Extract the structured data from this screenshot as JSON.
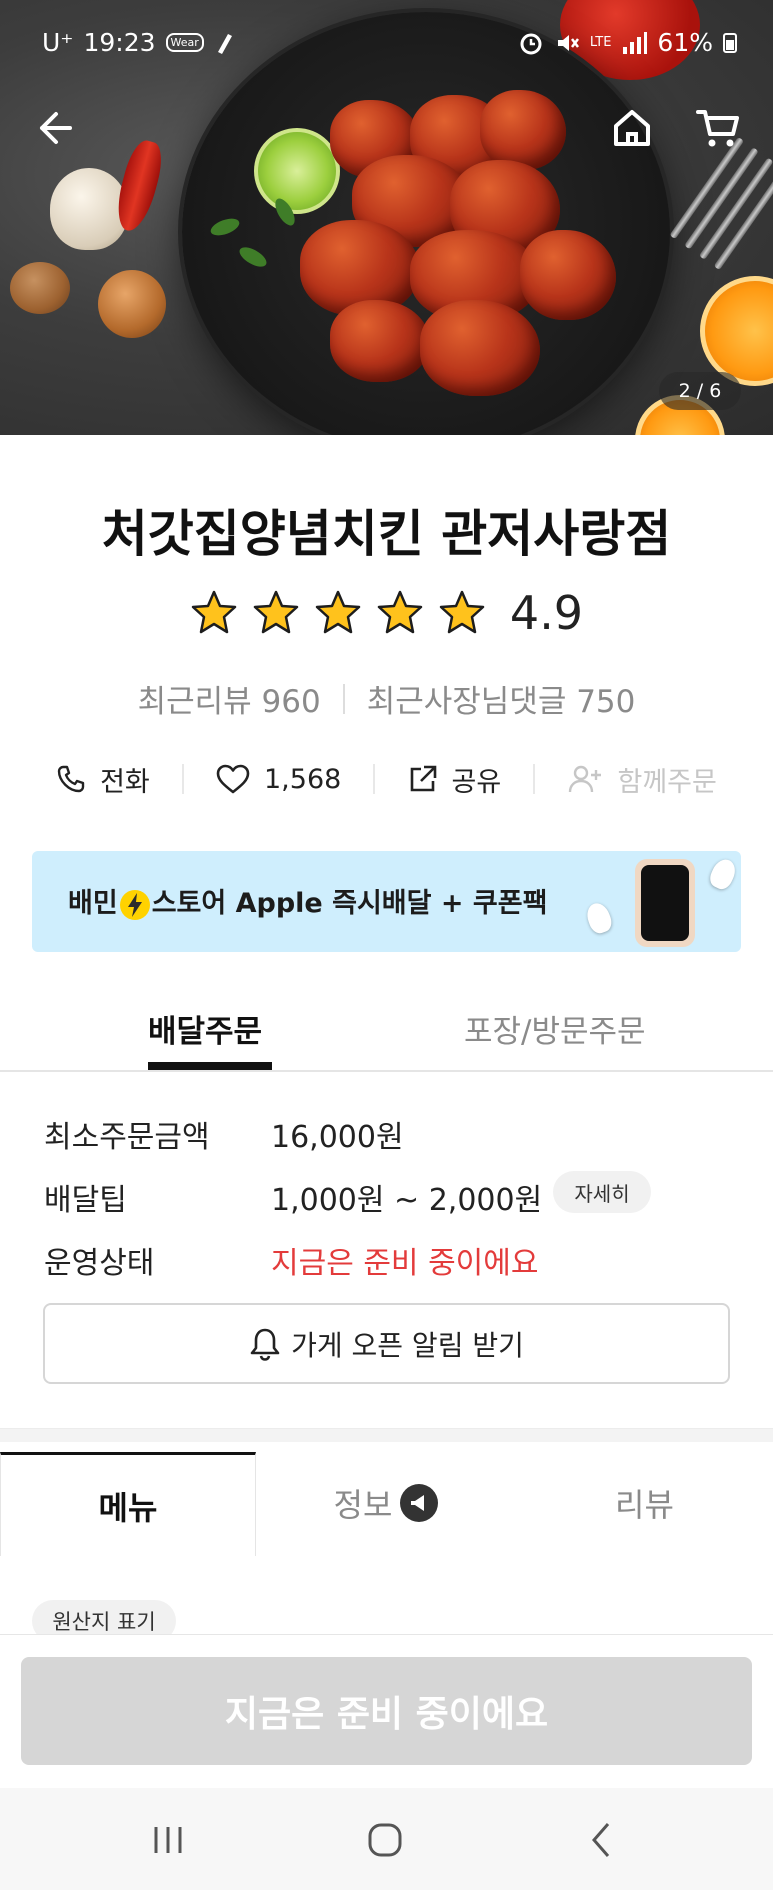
{
  "status_bar": {
    "carrier": "U⁺",
    "time": "19:23",
    "wear_badge": "Wear",
    "network": "LTE",
    "battery": "61%"
  },
  "hero": {
    "image_counter": "2 / 6",
    "back_icon": "back-arrow-icon",
    "home_icon": "home-icon",
    "cart_icon": "cart-icon"
  },
  "store": {
    "name": "처갓집양념치킨 관저사랑점",
    "rating": "4.9",
    "rating_stars": 5,
    "recent_reviews": "최근리뷰 960",
    "owner_comments": "최근사장님댓글 750"
  },
  "actions": {
    "phone": "전화",
    "likes": "1,568",
    "share": "공유",
    "group_order": "함께주문"
  },
  "banner": {
    "text_before": "배민",
    "text_after": "스토어 Apple 즉시배달 + 쿠폰팩"
  },
  "order_tabs": {
    "delivery": "배달주문",
    "pickup": "포장/방문주문"
  },
  "order_info": {
    "min_order_label": "최소주문금액",
    "min_order_value": "16,000원",
    "delivery_tip_label": "배달팁",
    "delivery_tip_value": "1,000원 ~ 2,000원",
    "detail_button": "자세히",
    "status_label": "운영상태",
    "status_value": "지금은 준비 중이에요"
  },
  "alert_button": "가게 오픈 알림 받기",
  "main_tabs": {
    "menu": "메뉴",
    "info": "정보",
    "review": "리뷰"
  },
  "origin_label": "원산지 표기",
  "cta": "지금은 준비 중이에요",
  "colors": {
    "status_red": "#e33b3b",
    "star_yellow": "#ffc21c",
    "banner_bg": "#cfeefd",
    "cta_disabled": "#d6d6d6"
  }
}
